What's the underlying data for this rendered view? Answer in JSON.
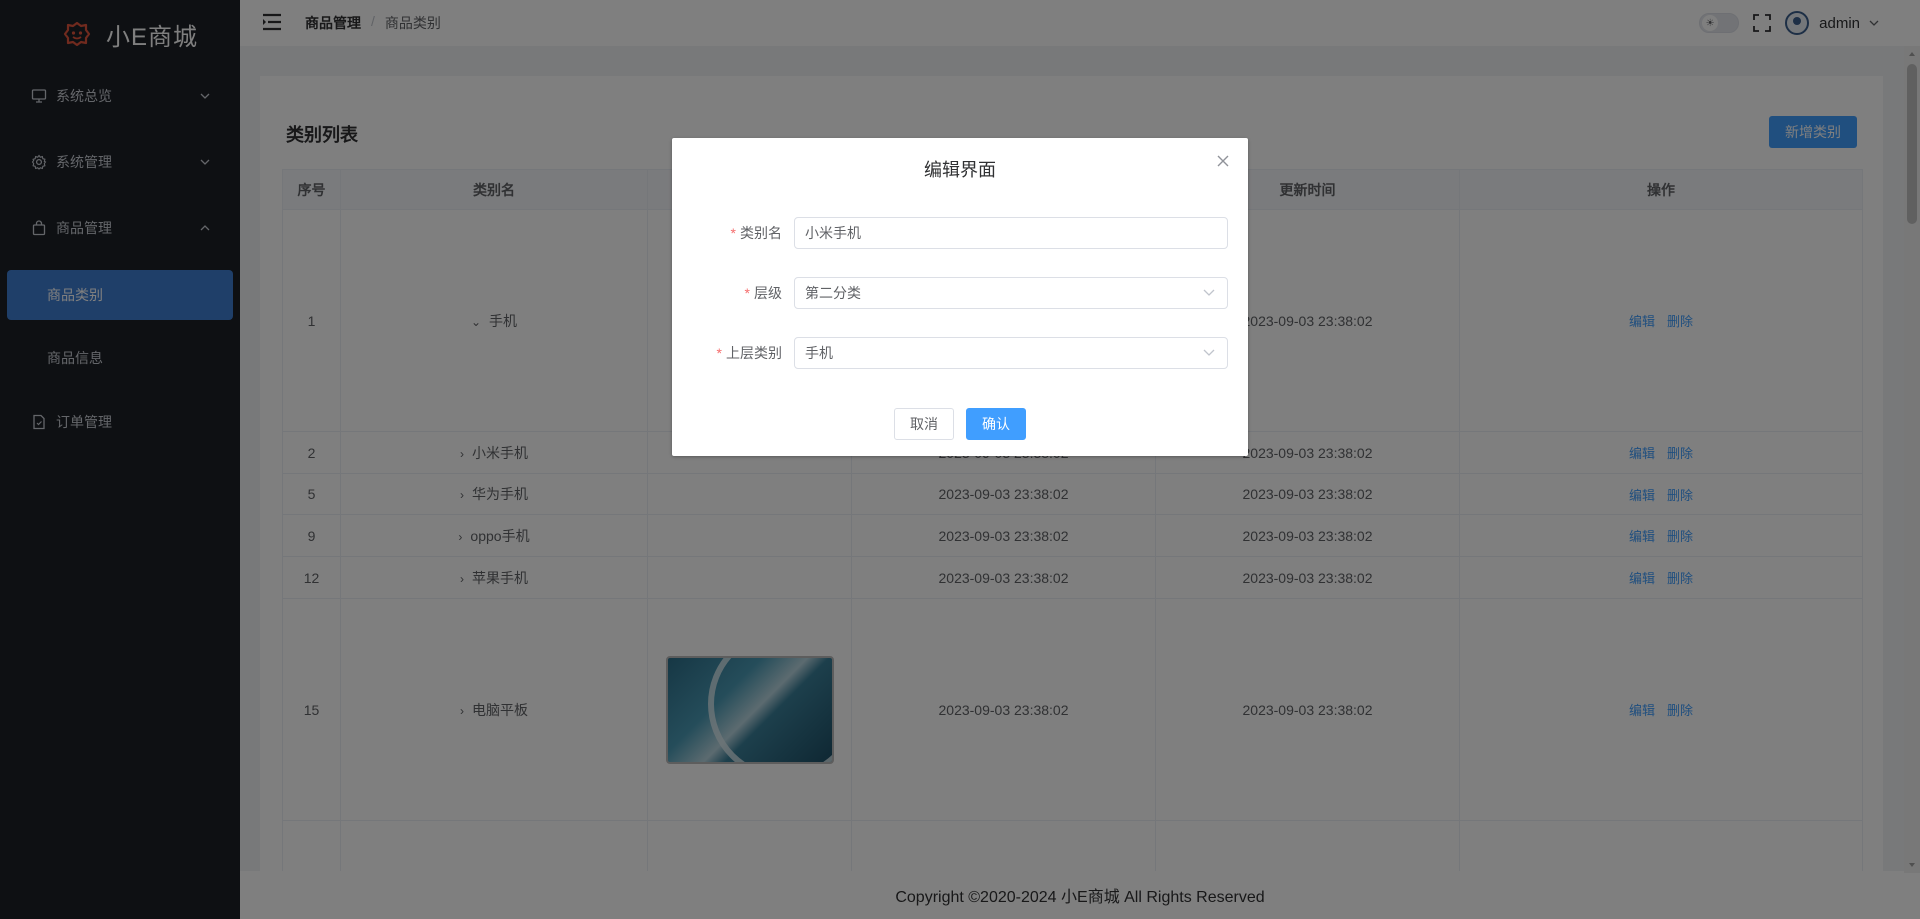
{
  "app": {
    "name": "小E商城"
  },
  "sidebar": {
    "items": [
      {
        "label": "系统总览",
        "icon": "monitor-icon"
      },
      {
        "label": "系统管理",
        "icon": "gear-icon"
      },
      {
        "label": "商品管理",
        "icon": "bag-icon"
      },
      {
        "label": "商品类别",
        "active": true
      },
      {
        "label": "商品信息"
      },
      {
        "label": "订单管理",
        "icon": "document-icon"
      }
    ]
  },
  "header": {
    "breadcrumb": [
      "商品管理",
      "商品类别"
    ],
    "separator": "/",
    "user": "admin",
    "theme_toggle_icon": "☀"
  },
  "page": {
    "title": "类别列表",
    "add_button": "新增类别"
  },
  "table": {
    "columns": [
      "序号",
      "类别名",
      "",
      "",
      "更新时间",
      "操作"
    ],
    "rows": [
      {
        "index": "1",
        "name": "手机",
        "expanded": true,
        "created": "",
        "updated": "2023-09-03 23:38:02"
      },
      {
        "index": "2",
        "name": "小米手机",
        "created": "2023-09-03 23:38:02",
        "updated": "2023-09-03 23:38:02"
      },
      {
        "index": "5",
        "name": "华为手机",
        "created": "2023-09-03 23:38:02",
        "updated": "2023-09-03 23:38:02"
      },
      {
        "index": "9",
        "name": "oppo手机",
        "created": "2023-09-03 23:38:02",
        "updated": "2023-09-03 23:38:02"
      },
      {
        "index": "12",
        "name": "苹果手机",
        "created": "2023-09-03 23:38:02",
        "updated": "2023-09-03 23:38:02"
      },
      {
        "index": "15",
        "name": "电脑平板",
        "created": "2023-09-03 23:38:02",
        "updated": "2023-09-03 23:38:02"
      }
    ],
    "actions": {
      "edit": "编辑",
      "delete": "删除"
    }
  },
  "footer": {
    "text": "Copyright ©2020-2024 小E商城 All Rights Reserved"
  },
  "dialog": {
    "title": "编辑界面",
    "fields": [
      {
        "label": "类别名",
        "value": "小米手机",
        "type": "input"
      },
      {
        "label": "层级",
        "value": "第二分类",
        "type": "select"
      },
      {
        "label": "上层类别",
        "value": "手机",
        "type": "select"
      }
    ],
    "cancel": "取消",
    "confirm": "确认"
  },
  "colors": {
    "primary": "#409eff",
    "sidebar_bg": "#1d2127",
    "active_menu": "#3f7ed3",
    "logo": "#e0543c",
    "required": "#f56c6c"
  }
}
